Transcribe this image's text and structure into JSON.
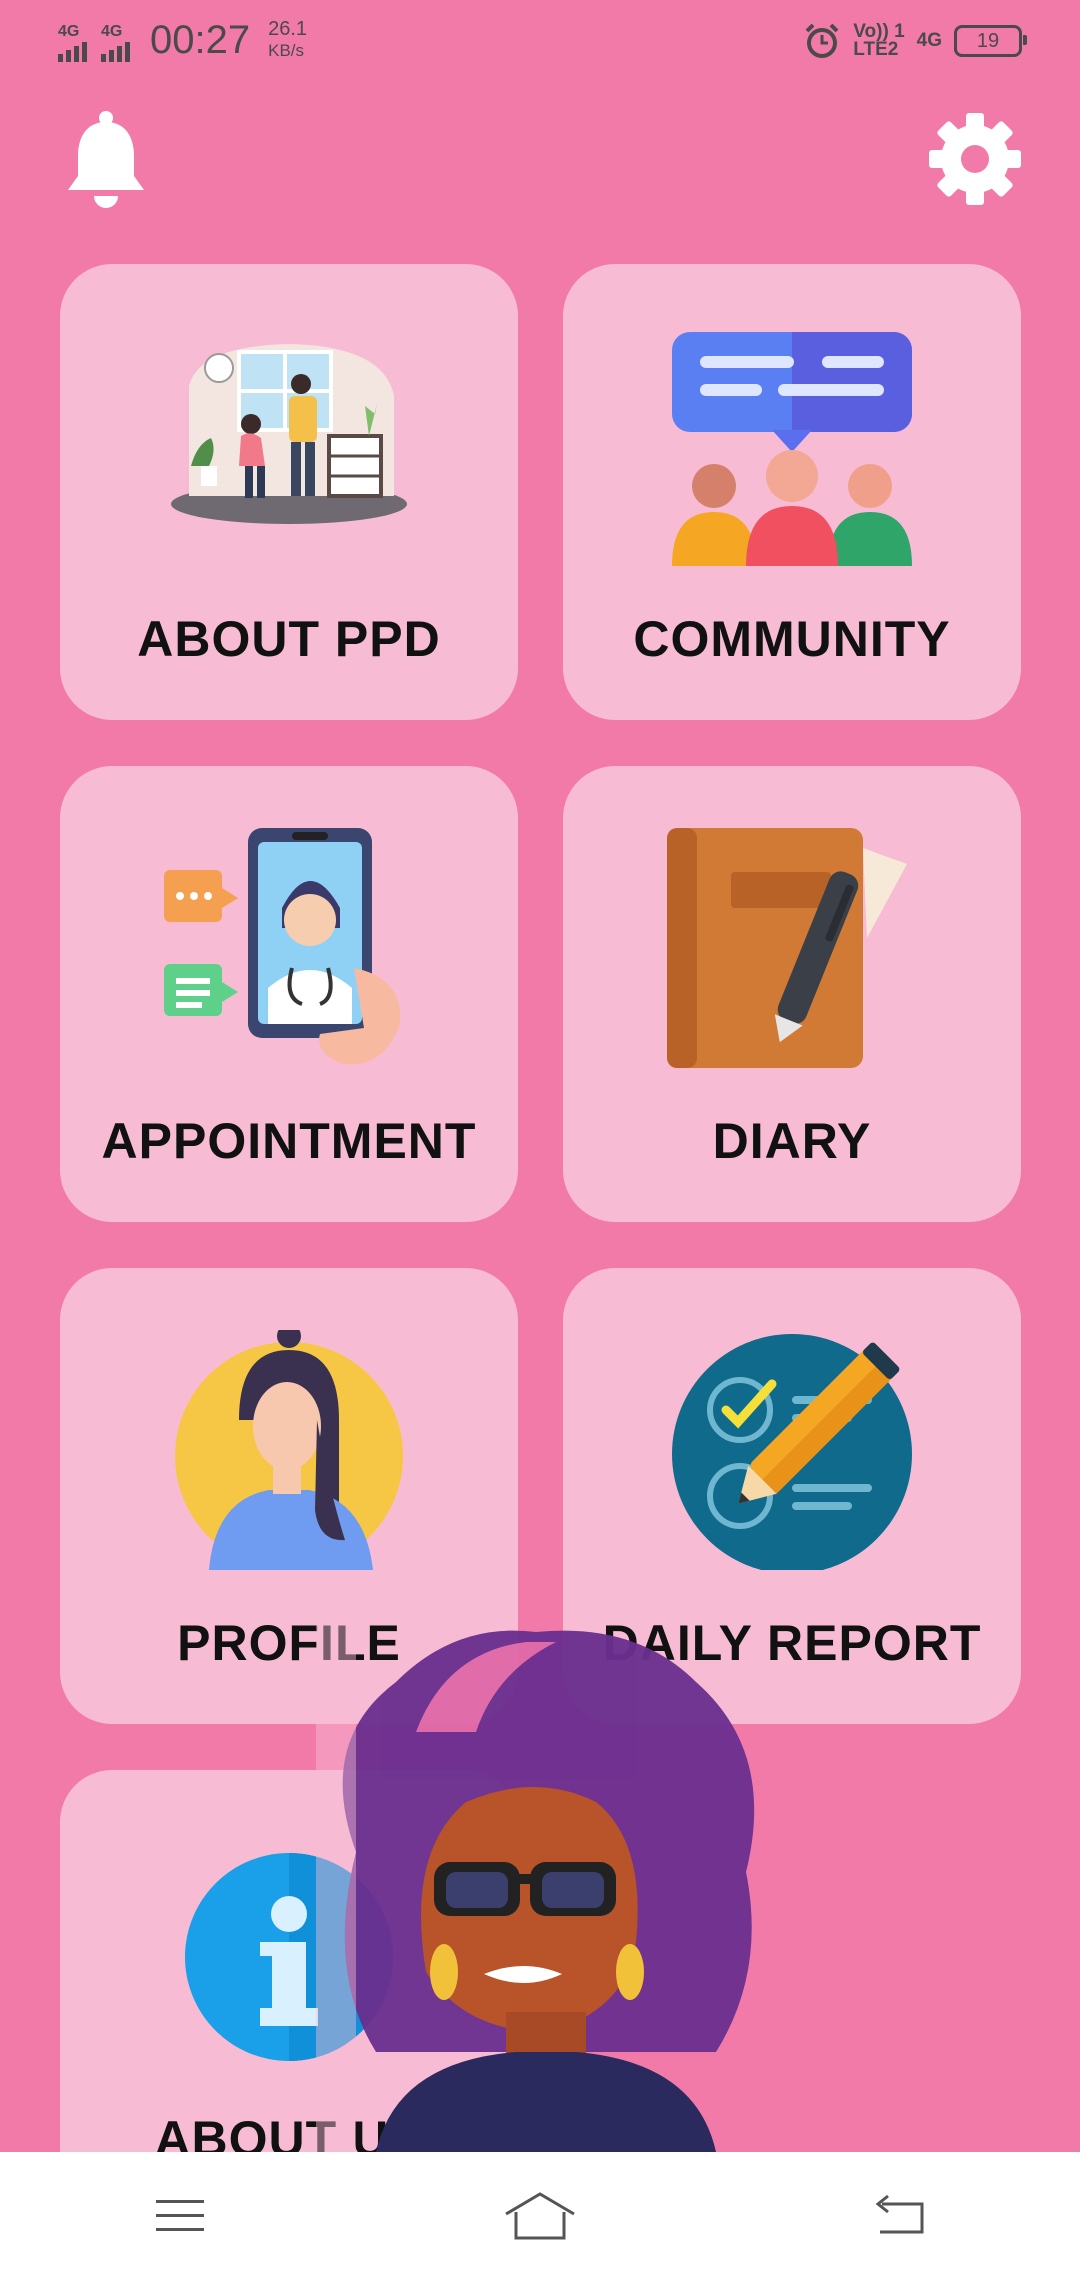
{
  "status_bar": {
    "sim1": "4G",
    "sim2": "4G",
    "time": "00:27",
    "speed_value": "26.1",
    "speed_unit": "KB/s",
    "volte": "Vo)) 1",
    "lte": "LTE2",
    "net": "4G",
    "battery": "19"
  },
  "header": {
    "bell_icon": "bell-icon",
    "gear_icon": "gear-icon"
  },
  "cards": [
    {
      "label": "ABOUT PPD",
      "icon": "family-illustration"
    },
    {
      "label": "COMMUNITY",
      "icon": "community-chat-icon"
    },
    {
      "label": "APPOINTMENT",
      "icon": "doctor-phone-icon"
    },
    {
      "label": "DIARY",
      "icon": "diary-pen-icon"
    },
    {
      "label": "PROFILE",
      "icon": "woman-avatar-icon"
    },
    {
      "label": "DAILY REPORT",
      "icon": "checklist-pencil-icon"
    },
    {
      "label": "ABOUT US",
      "icon": "info-icon"
    }
  ],
  "nav": {
    "menu_icon": "menu-icon",
    "home_icon": "home-icon",
    "back_icon": "back-icon"
  },
  "colors": {
    "background": "#f27aa9",
    "card": "#f7bcd4",
    "label": "#111111"
  }
}
